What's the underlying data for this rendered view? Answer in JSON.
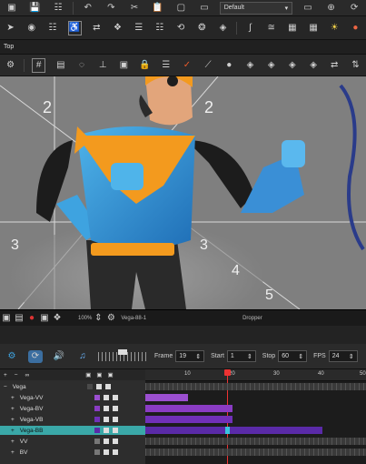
{
  "toolbar_top": {
    "preset_value": "Default"
  },
  "viewtitle": {
    "label": "Top"
  },
  "viewport": {
    "guide_numbers": [
      "2",
      "2",
      "3",
      "3",
      "4",
      "5"
    ],
    "accent": "#f39a1e"
  },
  "status": {
    "zoom": "100%",
    "drawing": "Vega-88-1",
    "tool": "Dropper"
  },
  "timeline": {
    "frame_label": "Frame",
    "frame_value": "19",
    "start_label": "Start",
    "start_value": "1",
    "stop_label": "Stop",
    "stop_value": "60",
    "fps_label": "FPS",
    "fps_value": "24",
    "ruler_ticks": [
      "10",
      "20",
      "30",
      "40",
      "50"
    ]
  },
  "layers": [
    {
      "name": "Vega",
      "color": "#4a4a4a"
    },
    {
      "name": "Vega-VV",
      "color": "#9b4fd0"
    },
    {
      "name": "Vega-BV",
      "color": "#8a3cc4"
    },
    {
      "name": "Vega-VB",
      "color": "#7030b8"
    },
    {
      "name": "Vega-BB",
      "color": "#5a2aa8"
    },
    {
      "name": "VV",
      "color": "#777777"
    },
    {
      "name": "BV",
      "color": "#777777"
    }
  ]
}
